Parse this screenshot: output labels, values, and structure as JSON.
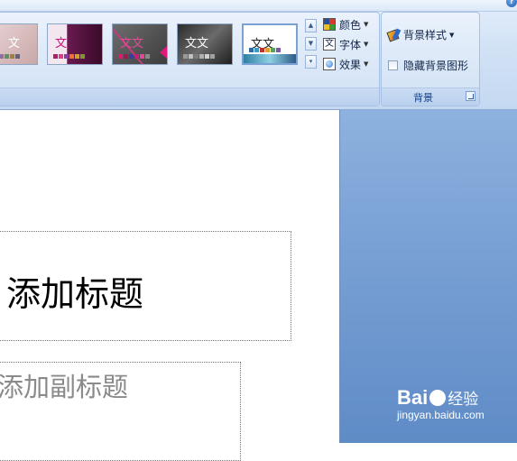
{
  "ribbon": {
    "themes": {
      "thumbnails": [
        {
          "text": "文"
        },
        {
          "text": "文"
        },
        {
          "text": "文文"
        },
        {
          "text": "文文"
        },
        {
          "text": "文文"
        }
      ],
      "commands": {
        "colors": "颜色",
        "fonts": "字体",
        "effects": "效果"
      }
    },
    "background": {
      "styles_label": "背景样式",
      "hide_graphics_label": "隐藏背景图形",
      "hide_graphics_checked": false,
      "group_label": "背景"
    }
  },
  "slide": {
    "title_placeholder": "添加标题",
    "subtitle_placeholder": "添加副标题"
  },
  "watermark": {
    "logo_text_1": "Bai",
    "logo_text_2": "经验",
    "url": "jingyan.baidu.com"
  },
  "colors": {
    "ribbon_bg": "#d3e3f6",
    "workspace_bg": "#7ca3d6",
    "group_caption_text": "#15428b"
  }
}
